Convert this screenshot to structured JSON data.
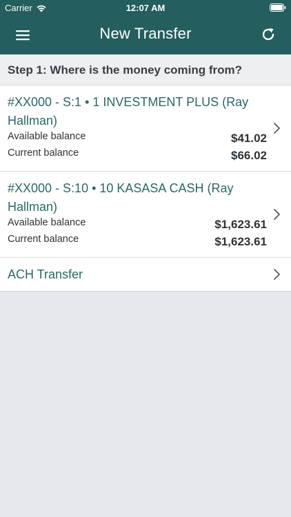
{
  "status_bar": {
    "carrier": "Carrier",
    "time": "12:07 AM"
  },
  "navbar": {
    "title": "New Transfer"
  },
  "step": {
    "label": "Step 1: Where is the money coming from?"
  },
  "accounts": [
    {
      "name": "#XX000 - S:1 • 1 INVESTMENT PLUS (Ray Hallman)",
      "available_label": "Available balance",
      "available_value": "$41.02",
      "current_label": "Current balance",
      "current_value": "$66.02"
    },
    {
      "name": "#XX000 - S:10 • 10 KASASA CASH (Ray Hallman)",
      "available_label": "Available balance",
      "available_value": "$1,623.61",
      "current_label": "Current balance",
      "current_value": "$1,623.61"
    }
  ],
  "ach": {
    "label": "ACH Transfer"
  },
  "colors": {
    "header": "#245e5e",
    "link_text": "#2a6866",
    "background": "#e6e8eb"
  },
  "icons": [
    "wifi-icon",
    "battery-icon",
    "hamburger-menu-icon",
    "refresh-icon",
    "chevron-right-icon"
  ]
}
